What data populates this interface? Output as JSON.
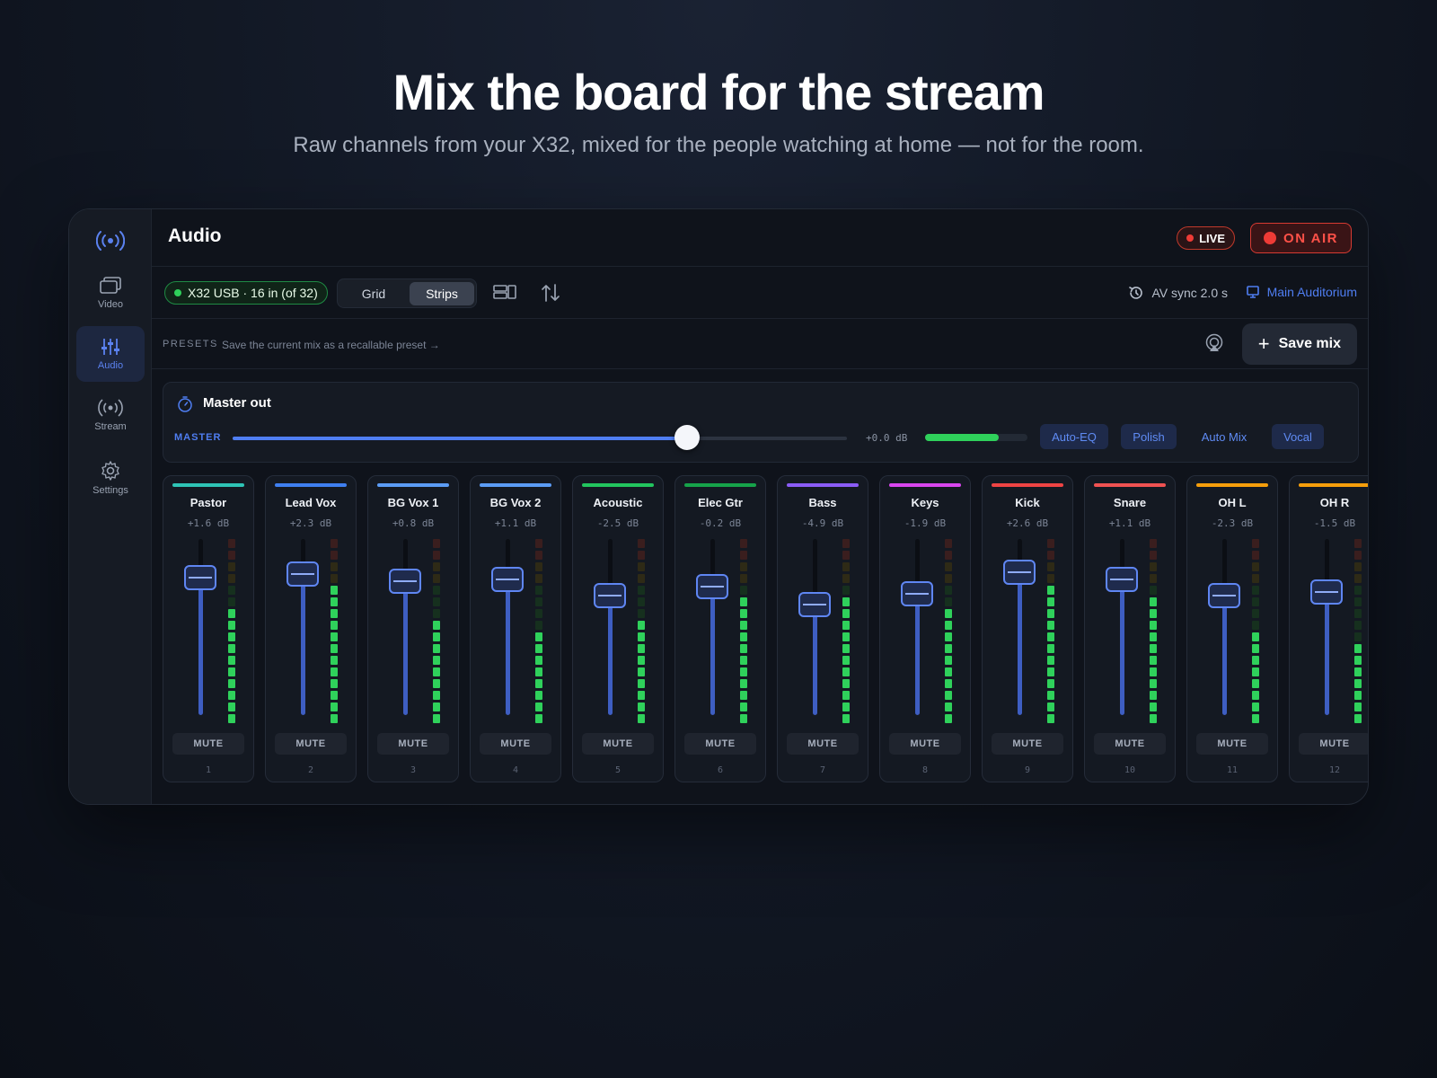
{
  "hero": {
    "title": "Mix the board for the stream",
    "subtitle": "Raw channels from your X32, mixed for the people watching at home — not for the room."
  },
  "sidebar": {
    "items": [
      {
        "label": "Video",
        "icon": "video-icon",
        "active": false
      },
      {
        "label": "Audio",
        "icon": "sliders-icon",
        "active": true
      },
      {
        "label": "Stream",
        "icon": "broadcast-icon",
        "active": false
      },
      {
        "label": "Settings",
        "icon": "gear-icon",
        "active": false
      }
    ]
  },
  "header": {
    "title": "Audio",
    "live_label": "LIVE",
    "on_air_label": "ON AIR"
  },
  "toolbar": {
    "source": "X32 USB · 16 in (of 32)",
    "view_grid": "Grid",
    "view_strips": "Strips",
    "active_view": "Strips",
    "av_sync": "AV sync 2.0 s",
    "room": "Main Auditorium"
  },
  "presets": {
    "label": "PRESETS",
    "hint": "Save the current mix as a recallable preset →",
    "save_label": "Save mix"
  },
  "master": {
    "title": "Master out",
    "label": "MASTER",
    "level": 0.74,
    "db": "+0.0 dB",
    "meter": 0.72,
    "chips": [
      {
        "label": "Auto-EQ",
        "on": true
      },
      {
        "label": "Polish",
        "on": true
      },
      {
        "label": "Auto Mix",
        "on": false
      },
      {
        "label": "Vocal",
        "on": true
      }
    ]
  },
  "colors": {
    "accent": "#4f7ef2",
    "live_red": "#ef3b36",
    "meter_green": "#2fd15b"
  },
  "channels": [
    {
      "name": "Pastor",
      "db": "+1.6 dB",
      "num": "1",
      "color": "#2ec4b6",
      "fader": 0.78,
      "meter": 0.62
    },
    {
      "name": "Lead Vox",
      "db": "+2.3 dB",
      "num": "2",
      "color": "#3f7ff0",
      "fader": 0.8,
      "meter": 0.75
    },
    {
      "name": "BG Vox 1",
      "db": "+0.8 dB",
      "num": "3",
      "color": "#5b9cf5",
      "fader": 0.76,
      "meter": 0.55
    },
    {
      "name": "BG Vox 2",
      "db": "+1.1 dB",
      "num": "4",
      "color": "#5b9cf5",
      "fader": 0.77,
      "meter": 0.5
    },
    {
      "name": "Acoustic",
      "db": "-2.5 dB",
      "num": "5",
      "color": "#22c55e",
      "fader": 0.68,
      "meter": 0.55
    },
    {
      "name": "Elec Gtr",
      "db": "-0.2 dB",
      "num": "6",
      "color": "#16a34a",
      "fader": 0.73,
      "meter": 0.68
    },
    {
      "name": "Bass",
      "db": "-4.9 dB",
      "num": "7",
      "color": "#8b5cf6",
      "fader": 0.63,
      "meter": 0.68
    },
    {
      "name": "Keys",
      "db": "-1.9 dB",
      "num": "8",
      "color": "#d946ef",
      "fader": 0.69,
      "meter": 0.62
    },
    {
      "name": "Kick",
      "db": "+2.6 dB",
      "num": "9",
      "color": "#ef4444",
      "fader": 0.81,
      "meter": 0.75
    },
    {
      "name": "Snare",
      "db": "+1.1 dB",
      "num": "10",
      "color": "#f05252",
      "fader": 0.77,
      "meter": 0.68
    },
    {
      "name": "OH L",
      "db": "-2.3 dB",
      "num": "11",
      "color": "#f59e0b",
      "fader": 0.68,
      "meter": 0.5
    },
    {
      "name": "OH R",
      "db": "-1.5 dB",
      "num": "12",
      "color": "#f59e0b",
      "fader": 0.7,
      "meter": 0.44
    }
  ],
  "mute_label": "MUTE"
}
